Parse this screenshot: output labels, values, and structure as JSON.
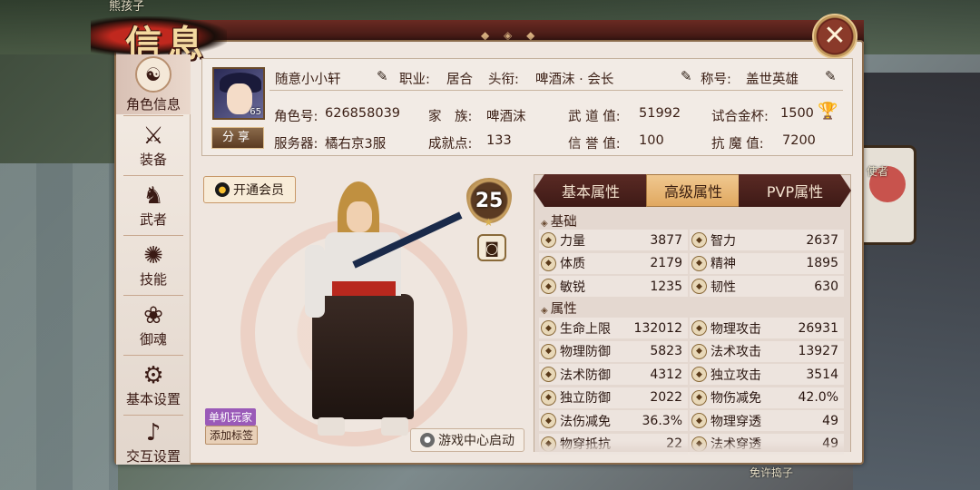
{
  "background": {
    "top_text": "熊孩子",
    "right_text": "使者",
    "bottom_text": "免许捣子"
  },
  "window": {
    "title": "信息"
  },
  "sidebar": {
    "items": [
      {
        "label": "角色信息",
        "icon": "character-icon"
      },
      {
        "label": "装备",
        "icon": "swords-icon"
      },
      {
        "label": "武者",
        "icon": "warrior-icon"
      },
      {
        "label": "技能",
        "icon": "skill-icon"
      },
      {
        "label": "御魂",
        "icon": "soul-icon"
      },
      {
        "label": "基本设置",
        "icon": "gear-icon"
      },
      {
        "label": "交互设置",
        "icon": "interaction-icon"
      }
    ]
  },
  "profile": {
    "avatar_level": "65",
    "name": "随意小小轩",
    "job_label": "职业:",
    "job": "居合",
    "rank_label": "头衔:",
    "rank": "啤酒沫 · 会长",
    "title_label": "称号:",
    "title": "盖世英雄",
    "share": "分享",
    "id_label": "角色号:",
    "id": "626858039",
    "family_label": "家　族:",
    "family": "啤酒沫",
    "wudao_label": "武 道 值:",
    "wudao": "51992",
    "cup_label": "试合金杯:",
    "cup": "1500",
    "server_label": "服务器:",
    "server": "橘右京3服",
    "achieve_label": "成就点:",
    "achieve": "133",
    "honor_label": "信 誉 值:",
    "honor": "100",
    "resist_label": "抗 魔 值:",
    "resist": "7200"
  },
  "vip_button": "开通会员",
  "level": "25",
  "tags": {
    "solo": "单机玩家",
    "add": "添加标签"
  },
  "launch_button": "游戏中心启动",
  "attr_tabs": [
    "基本属性",
    "高级属性",
    "PVP属性"
  ],
  "attr_active_tab": 1,
  "sections": {
    "basic": "基础",
    "attrs": "属性"
  },
  "basic_stats": [
    {
      "l": {
        "name": "力量",
        "val": "3877"
      },
      "r": {
        "name": "智力",
        "val": "2637"
      }
    },
    {
      "l": {
        "name": "体质",
        "val": "2179"
      },
      "r": {
        "name": "精神",
        "val": "1895"
      }
    },
    {
      "l": {
        "name": "敏锐",
        "val": "1235"
      },
      "r": {
        "name": "韧性",
        "val": "630"
      }
    }
  ],
  "attr_stats": [
    {
      "l": {
        "name": "生命上限",
        "val": "132012"
      },
      "r": {
        "name": "物理攻击",
        "val": "26931"
      }
    },
    {
      "l": {
        "name": "物理防御",
        "val": "5823"
      },
      "r": {
        "name": "法术攻击",
        "val": "13927"
      }
    },
    {
      "l": {
        "name": "法术防御",
        "val": "4312"
      },
      "r": {
        "name": "独立攻击",
        "val": "3514"
      }
    },
    {
      "l": {
        "name": "独立防御",
        "val": "2022"
      },
      "r": {
        "name": "物伤减免",
        "val": "42.0%"
      }
    },
    {
      "l": {
        "name": "法伤减免",
        "val": "36.3%"
      },
      "r": {
        "name": "物理穿透",
        "val": "49"
      }
    },
    {
      "l": {
        "name": "物穿抵抗",
        "val": "22"
      },
      "r": {
        "name": "法术穿透",
        "val": "49"
      }
    }
  ],
  "colors": {
    "accent": "#5a2a24",
    "tab_active": "#e8b070",
    "panel": "#efe6df"
  }
}
